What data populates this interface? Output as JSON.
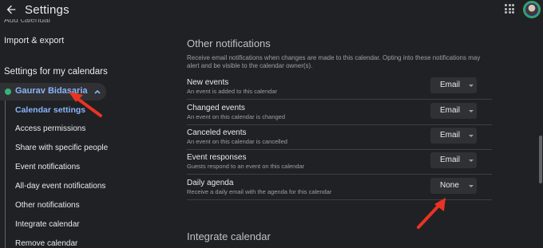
{
  "header": {
    "title": "Settings"
  },
  "sidebar": {
    "cut_item": "Add calendar",
    "import_export": "Import & export",
    "section_heading": "Settings for my calendars",
    "calendar_name": "Gaurav Bidasaria",
    "calendar_color": "#33b679",
    "sub_items": [
      "Calendar settings",
      "Access permissions",
      "Share with specific people",
      "Event notifications",
      "All-day event notifications",
      "Other notifications",
      "Integrate calendar",
      "Remove calendar"
    ]
  },
  "main": {
    "section_title": "Other notifications",
    "description": "Receive email notifications when changes are made to this calendar. Opting into these notifications may alert and be visible to the calendar owner(s).",
    "rows": [
      {
        "label": "New events",
        "sub": "An event is added to this calendar",
        "value": "Email"
      },
      {
        "label": "Changed events",
        "sub": "An event on this calendar is changed",
        "value": "Email"
      },
      {
        "label": "Canceled events",
        "sub": "An event on this calendar is cancelled",
        "value": "Email"
      },
      {
        "label": "Event responses",
        "sub": "Guests respond to an event on this calendar",
        "value": "Email"
      },
      {
        "label": "Daily agenda",
        "sub": "Receive a daily email with the agenda for this calendar",
        "value": "None"
      }
    ],
    "next_section_title": "Integrate calendar"
  },
  "icons": {
    "back": "arrow-back-icon",
    "apps": "apps-grid-icon",
    "chevron": "chevron-up-icon",
    "caret": "dropdown-caret-icon"
  },
  "colors": {
    "accent": "#8ab4f8",
    "annotation": "#ea3323",
    "background": "#202124"
  }
}
